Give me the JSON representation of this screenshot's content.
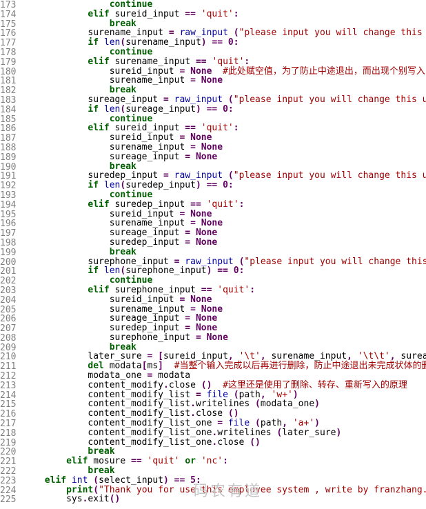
{
  "lines": [
    {
      "n": "173",
      "indent": 16,
      "tok": [
        [
          "kw",
          "continue"
        ]
      ]
    },
    {
      "n": "174",
      "indent": 12,
      "tok": [
        [
          "kw",
          "elif"
        ],
        [
          "ident",
          " sureid_input "
        ],
        [
          "op",
          "=="
        ],
        [
          "ident",
          " "
        ],
        [
          "str",
          "'quit'"
        ],
        [
          "op",
          ":"
        ]
      ]
    },
    {
      "n": "175",
      "indent": 16,
      "tok": [
        [
          "kw",
          "break"
        ]
      ]
    },
    {
      "n": "176",
      "indent": 12,
      "tok": [
        [
          "ident",
          "surename_input "
        ],
        [
          "op",
          "="
        ],
        [
          "ident",
          " "
        ],
        [
          "fn-blue",
          "raw_input"
        ],
        [
          "ident",
          " "
        ],
        [
          "op",
          "("
        ],
        [
          "str",
          "\"please input you will change this user nam"
        ]
      ]
    },
    {
      "n": "177",
      "indent": 12,
      "tok": [
        [
          "kw",
          "if"
        ],
        [
          "ident",
          " "
        ],
        [
          "fn-blue",
          "len"
        ],
        [
          "op",
          "("
        ],
        [
          "ident",
          "surename_input"
        ],
        [
          "op",
          ")"
        ],
        [
          "ident",
          " "
        ],
        [
          "op",
          "=="
        ],
        [
          "ident",
          " "
        ],
        [
          "num",
          "0"
        ],
        [
          "op",
          ":"
        ]
      ]
    },
    {
      "n": "178",
      "indent": 16,
      "tok": [
        [
          "kw",
          "continue"
        ]
      ]
    },
    {
      "n": "179",
      "indent": 12,
      "tok": [
        [
          "kw",
          "elif"
        ],
        [
          "ident",
          " surename_input "
        ],
        [
          "op",
          "=="
        ],
        [
          "ident",
          " "
        ],
        [
          "str",
          "'quit'"
        ],
        [
          "op",
          ":"
        ]
      ]
    },
    {
      "n": "180",
      "indent": 16,
      "tok": [
        [
          "ident",
          "sureid_input "
        ],
        [
          "op",
          "="
        ],
        [
          "ident",
          " "
        ],
        [
          "const",
          "None"
        ],
        [
          "ident",
          "  "
        ],
        [
          "comment",
          "#此处赋空值，为了防止中途退出，而出现个别写入"
        ]
      ]
    },
    {
      "n": "181",
      "indent": 16,
      "tok": [
        [
          "ident",
          "surename_input "
        ],
        [
          "op",
          "="
        ],
        [
          "ident",
          " "
        ],
        [
          "const",
          "None"
        ]
      ]
    },
    {
      "n": "182",
      "indent": 16,
      "tok": [
        [
          "kw",
          "break"
        ]
      ]
    },
    {
      "n": "183",
      "indent": 12,
      "tok": [
        [
          "ident",
          "sureage_input "
        ],
        [
          "op",
          "="
        ],
        [
          "ident",
          " "
        ],
        [
          "fn-blue",
          "raw_input"
        ],
        [
          "ident",
          " "
        ],
        [
          "op",
          "("
        ],
        [
          "str",
          "\"please input you will change this user age:"
        ]
      ]
    },
    {
      "n": "184",
      "indent": 12,
      "tok": [
        [
          "kw",
          "if"
        ],
        [
          "ident",
          " "
        ],
        [
          "fn-blue",
          "len"
        ],
        [
          "op",
          "("
        ],
        [
          "ident",
          "sureage_input"
        ],
        [
          "op",
          ")"
        ],
        [
          "ident",
          " "
        ],
        [
          "op",
          "=="
        ],
        [
          "ident",
          " "
        ],
        [
          "num",
          "0"
        ],
        [
          "op",
          ":"
        ]
      ]
    },
    {
      "n": "185",
      "indent": 16,
      "tok": [
        [
          "kw",
          "continue"
        ]
      ]
    },
    {
      "n": "186",
      "indent": 12,
      "tok": [
        [
          "kw",
          "elif"
        ],
        [
          "ident",
          " sureid_input "
        ],
        [
          "op",
          "=="
        ],
        [
          "ident",
          " "
        ],
        [
          "str",
          "'quit'"
        ],
        [
          "op",
          ":"
        ]
      ]
    },
    {
      "n": "187",
      "indent": 16,
      "tok": [
        [
          "ident",
          "sureid_input "
        ],
        [
          "op",
          "="
        ],
        [
          "ident",
          " "
        ],
        [
          "const",
          "None"
        ]
      ]
    },
    {
      "n": "188",
      "indent": 16,
      "tok": [
        [
          "ident",
          "surename_input "
        ],
        [
          "op",
          "="
        ],
        [
          "ident",
          " "
        ],
        [
          "const",
          "None"
        ]
      ]
    },
    {
      "n": "189",
      "indent": 16,
      "tok": [
        [
          "ident",
          "sureage_input "
        ],
        [
          "op",
          "="
        ],
        [
          "ident",
          " "
        ],
        [
          "const",
          "None"
        ]
      ]
    },
    {
      "n": "190",
      "indent": 16,
      "tok": [
        [
          "kw",
          "break"
        ]
      ]
    },
    {
      "n": "191",
      "indent": 12,
      "tok": [
        [
          "ident",
          "suredep_input "
        ],
        [
          "op",
          "="
        ],
        [
          "ident",
          " "
        ],
        [
          "fn-blue",
          "raw_input"
        ],
        [
          "ident",
          " "
        ],
        [
          "op",
          "("
        ],
        [
          "str",
          "\"please input you will change this user depa"
        ]
      ]
    },
    {
      "n": "192",
      "indent": 12,
      "tok": [
        [
          "kw",
          "if"
        ],
        [
          "ident",
          " "
        ],
        [
          "fn-blue",
          "len"
        ],
        [
          "op",
          "("
        ],
        [
          "ident",
          "suredep_input"
        ],
        [
          "op",
          ")"
        ],
        [
          "ident",
          " "
        ],
        [
          "op",
          "=="
        ],
        [
          "ident",
          " "
        ],
        [
          "num",
          "0"
        ],
        [
          "op",
          ":"
        ]
      ]
    },
    {
      "n": "193",
      "indent": 16,
      "tok": [
        [
          "kw",
          "continue"
        ]
      ]
    },
    {
      "n": "194",
      "indent": 12,
      "tok": [
        [
          "kw",
          "elif"
        ],
        [
          "ident",
          " suredep_input "
        ],
        [
          "op",
          "=="
        ],
        [
          "ident",
          " "
        ],
        [
          "str",
          "'quit'"
        ],
        [
          "op",
          ":"
        ]
      ]
    },
    {
      "n": "195",
      "indent": 16,
      "tok": [
        [
          "ident",
          "sureid_input "
        ],
        [
          "op",
          "="
        ],
        [
          "ident",
          " "
        ],
        [
          "const",
          "None"
        ]
      ]
    },
    {
      "n": "196",
      "indent": 16,
      "tok": [
        [
          "ident",
          "surename_input "
        ],
        [
          "op",
          "="
        ],
        [
          "ident",
          " "
        ],
        [
          "const",
          "None"
        ]
      ]
    },
    {
      "n": "197",
      "indent": 16,
      "tok": [
        [
          "ident",
          "sureage_input "
        ],
        [
          "op",
          "="
        ],
        [
          "ident",
          " "
        ],
        [
          "const",
          "None"
        ]
      ]
    },
    {
      "n": "198",
      "indent": 16,
      "tok": [
        [
          "ident",
          "suredep_input "
        ],
        [
          "op",
          "="
        ],
        [
          "ident",
          " "
        ],
        [
          "const",
          "None"
        ]
      ]
    },
    {
      "n": "199",
      "indent": 16,
      "tok": [
        [
          "kw",
          "break"
        ]
      ]
    },
    {
      "n": "200",
      "indent": 12,
      "tok": [
        [
          "ident",
          "surephone_input "
        ],
        [
          "op",
          "="
        ],
        [
          "ident",
          " "
        ],
        [
          "fn-blue",
          "raw_input"
        ],
        [
          "ident",
          " "
        ],
        [
          "op",
          "("
        ],
        [
          "str",
          "\"please input you will change this user ph"
        ]
      ]
    },
    {
      "n": "201",
      "indent": 12,
      "tok": [
        [
          "kw",
          "if"
        ],
        [
          "ident",
          " "
        ],
        [
          "fn-blue",
          "len"
        ],
        [
          "op",
          "("
        ],
        [
          "ident",
          "surephone_input"
        ],
        [
          "op",
          ")"
        ],
        [
          "ident",
          " "
        ],
        [
          "op",
          "=="
        ],
        [
          "ident",
          " "
        ],
        [
          "num",
          "0"
        ],
        [
          "op",
          ":"
        ]
      ]
    },
    {
      "n": "202",
      "indent": 16,
      "tok": [
        [
          "kw",
          "continue"
        ]
      ]
    },
    {
      "n": "203",
      "indent": 12,
      "tok": [
        [
          "kw",
          "elif"
        ],
        [
          "ident",
          " surephone_input "
        ],
        [
          "op",
          "=="
        ],
        [
          "ident",
          " "
        ],
        [
          "str",
          "'quit'"
        ],
        [
          "op",
          ":"
        ]
      ]
    },
    {
      "n": "204",
      "indent": 16,
      "tok": [
        [
          "ident",
          "sureid_input "
        ],
        [
          "op",
          "="
        ],
        [
          "ident",
          " "
        ],
        [
          "const",
          "None"
        ]
      ]
    },
    {
      "n": "205",
      "indent": 16,
      "tok": [
        [
          "ident",
          "surename_input "
        ],
        [
          "op",
          "="
        ],
        [
          "ident",
          " "
        ],
        [
          "const",
          "None"
        ]
      ]
    },
    {
      "n": "206",
      "indent": 16,
      "tok": [
        [
          "ident",
          "sureage_input "
        ],
        [
          "op",
          "="
        ],
        [
          "ident",
          " "
        ],
        [
          "const",
          "None"
        ]
      ]
    },
    {
      "n": "207",
      "indent": 16,
      "tok": [
        [
          "ident",
          "suredep_input "
        ],
        [
          "op",
          "="
        ],
        [
          "ident",
          " "
        ],
        [
          "const",
          "None"
        ]
      ]
    },
    {
      "n": "208",
      "indent": 16,
      "tok": [
        [
          "ident",
          "surephone_input "
        ],
        [
          "op",
          "="
        ],
        [
          "ident",
          " "
        ],
        [
          "const",
          "None"
        ]
      ]
    },
    {
      "n": "209",
      "indent": 16,
      "tok": [
        [
          "kw",
          "break"
        ]
      ]
    },
    {
      "n": "210",
      "indent": 12,
      "tok": [
        [
          "ident",
          "later_sure "
        ],
        [
          "op",
          "="
        ],
        [
          "ident",
          " "
        ],
        [
          "op",
          "["
        ],
        [
          "ident",
          "sureid_input"
        ],
        [
          "op",
          ","
        ],
        [
          "ident",
          " "
        ],
        [
          "str",
          "'\\t'"
        ],
        [
          "op",
          ","
        ],
        [
          "ident",
          " surename_input"
        ],
        [
          "op",
          ","
        ],
        [
          "ident",
          " "
        ],
        [
          "str",
          "'\\t\\t'"
        ],
        [
          "op",
          ","
        ],
        [
          "ident",
          " sureage_input"
        ]
      ]
    },
    {
      "n": "211",
      "indent": 12,
      "tok": [
        [
          "kw",
          "del"
        ],
        [
          "ident",
          " modata"
        ],
        [
          "op",
          "["
        ],
        [
          "ident",
          "ms"
        ],
        [
          "op",
          "]"
        ],
        [
          "ident",
          "  "
        ],
        [
          "comment",
          "#当整个输入完成以后再进行删除，防止中途退出未完成状体的删除。"
        ]
      ]
    },
    {
      "n": "212",
      "indent": 12,
      "tok": [
        [
          "ident",
          "modata_one "
        ],
        [
          "op",
          "="
        ],
        [
          "ident",
          " modata"
        ]
      ]
    },
    {
      "n": "213",
      "indent": 12,
      "tok": [
        [
          "ident",
          "content_modify"
        ],
        [
          "op",
          "."
        ],
        [
          "ident",
          "close "
        ],
        [
          "op",
          "()"
        ],
        [
          "ident",
          "  "
        ],
        [
          "comment",
          "#这里还是使用了删除、转存、重新写入的原理"
        ]
      ]
    },
    {
      "n": "214",
      "indent": 12,
      "tok": [
        [
          "ident",
          "content_modify_list "
        ],
        [
          "op",
          "="
        ],
        [
          "ident",
          " "
        ],
        [
          "fn-blue",
          "file"
        ],
        [
          "ident",
          " "
        ],
        [
          "op",
          "("
        ],
        [
          "ident",
          "path"
        ],
        [
          "op",
          ","
        ],
        [
          "ident",
          " "
        ],
        [
          "str",
          "'w+'"
        ],
        [
          "op",
          ")"
        ]
      ]
    },
    {
      "n": "215",
      "indent": 12,
      "tok": [
        [
          "ident",
          "content_modify_list"
        ],
        [
          "op",
          "."
        ],
        [
          "ident",
          "writelines "
        ],
        [
          "op",
          "("
        ],
        [
          "ident",
          "modata_one"
        ],
        [
          "op",
          ")"
        ]
      ]
    },
    {
      "n": "216",
      "indent": 12,
      "tok": [
        [
          "ident",
          "content_modify_list"
        ],
        [
          "op",
          "."
        ],
        [
          "ident",
          "close "
        ],
        [
          "op",
          "()"
        ]
      ]
    },
    {
      "n": "217",
      "indent": 12,
      "tok": [
        [
          "ident",
          "content_modify_list_one "
        ],
        [
          "op",
          "="
        ],
        [
          "ident",
          " "
        ],
        [
          "fn-blue",
          "file"
        ],
        [
          "ident",
          " "
        ],
        [
          "op",
          "("
        ],
        [
          "ident",
          "path"
        ],
        [
          "op",
          ","
        ],
        [
          "ident",
          " "
        ],
        [
          "str",
          "'a+'"
        ],
        [
          "op",
          ")"
        ]
      ]
    },
    {
      "n": "218",
      "indent": 12,
      "tok": [
        [
          "ident",
          "content_modify_list_one"
        ],
        [
          "op",
          "."
        ],
        [
          "ident",
          "writelines "
        ],
        [
          "op",
          "("
        ],
        [
          "ident",
          "later_sure"
        ],
        [
          "op",
          ")"
        ]
      ]
    },
    {
      "n": "219",
      "indent": 12,
      "tok": [
        [
          "ident",
          "content_modify_list_one"
        ],
        [
          "op",
          "."
        ],
        [
          "ident",
          "close "
        ],
        [
          "op",
          "()"
        ]
      ]
    },
    {
      "n": "220",
      "indent": 12,
      "tok": [
        [
          "kw",
          "break"
        ]
      ]
    },
    {
      "n": "221",
      "indent": 8,
      "tok": [
        [
          "kw",
          "elif"
        ],
        [
          "ident",
          " mosure "
        ],
        [
          "op",
          "=="
        ],
        [
          "ident",
          " "
        ],
        [
          "str",
          "'quit'"
        ],
        [
          "ident",
          " "
        ],
        [
          "kw",
          "or"
        ],
        [
          "ident",
          " "
        ],
        [
          "str",
          "'nc'"
        ],
        [
          "op",
          ":"
        ]
      ]
    },
    {
      "n": "222",
      "indent": 12,
      "tok": [
        [
          "kw",
          "break"
        ]
      ]
    },
    {
      "n": "223",
      "indent": 4,
      "tok": [
        [
          "kw",
          "elif"
        ],
        [
          "ident",
          " "
        ],
        [
          "fn-blue",
          "int"
        ],
        [
          "ident",
          " "
        ],
        [
          "op",
          "("
        ],
        [
          "ident",
          "select_input"
        ],
        [
          "op",
          ")"
        ],
        [
          "ident",
          " "
        ],
        [
          "op",
          "=="
        ],
        [
          "ident",
          " "
        ],
        [
          "num",
          "5"
        ],
        [
          "op",
          ":"
        ]
      ]
    },
    {
      "n": "224",
      "indent": 8,
      "tok": [
        [
          "print",
          "print"
        ],
        [
          "op",
          "("
        ],
        [
          "str",
          "\"Thank you for use this employee system , write by franzhang.\""
        ],
        [
          "op",
          ")"
        ]
      ]
    },
    {
      "n": "225",
      "indent": 8,
      "tok": [
        [
          "ident",
          "sys"
        ],
        [
          "op",
          "."
        ],
        [
          "ident",
          "exit"
        ],
        [
          "op",
          "()"
        ]
      ]
    }
  ],
  "watermark": "码农有道"
}
